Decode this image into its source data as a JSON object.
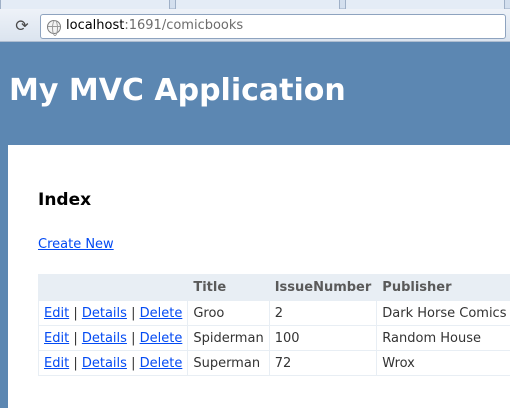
{
  "browser": {
    "url_host": "localhost",
    "url_rest": ":1691/comicbooks"
  },
  "site": {
    "title": "My MVC Application"
  },
  "page": {
    "heading": "Index",
    "create_link": "Create New"
  },
  "table": {
    "headers": [
      "",
      "Title",
      "IssueNumber",
      "Publisher"
    ],
    "actions": {
      "edit": "Edit",
      "details": "Details",
      "delete": "Delete",
      "separator": "|"
    },
    "rows": [
      {
        "title": "Groo",
        "issue": "2",
        "publisher": "Dark Horse Comics"
      },
      {
        "title": "Spiderman",
        "issue": "100",
        "publisher": "Random House"
      },
      {
        "title": "Superman",
        "issue": "72",
        "publisher": "Wrox"
      }
    ]
  },
  "colors": {
    "header_bg": "#5c87b2",
    "link": "#034af3",
    "table_header_bg": "#e8eef4"
  },
  "icons": {
    "reload": "reload-icon",
    "page": "globe-icon"
  }
}
